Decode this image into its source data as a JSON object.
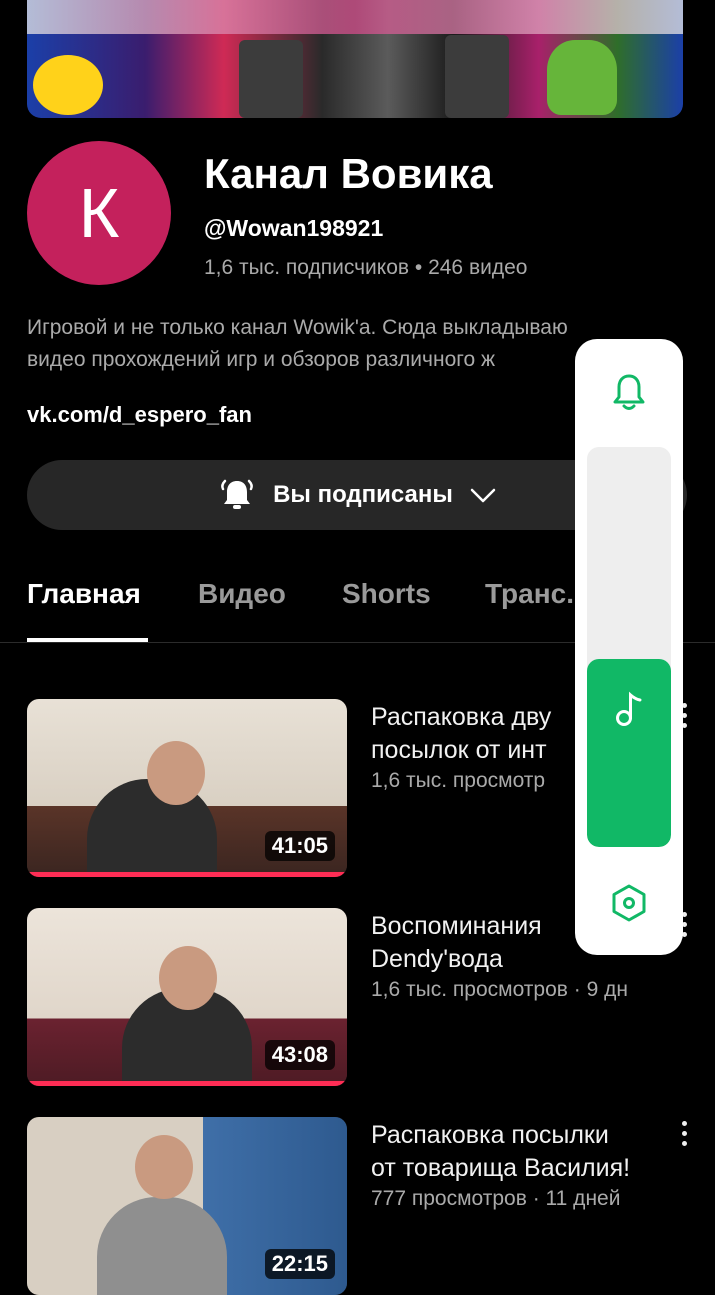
{
  "channel": {
    "avatar_letter": "К",
    "title": "Канал Вовика",
    "handle": "@Wowan198921",
    "stats": "1,6 тыс. подписчиков • 246 видео",
    "description": "Игровой и не только канал Wowik'a. Сюда выкладываю\nвидео прохождений игр и обзоров различного ж",
    "link": "vk.com/d_espero_fan"
  },
  "subscribe": {
    "label": "Вы подписаны",
    "bell_icon": "bell-ringing-icon",
    "chevron_icon": "chevron-down-icon"
  },
  "tabs": [
    {
      "label": "Главная",
      "active": true
    },
    {
      "label": "Видео",
      "active": false
    },
    {
      "label": "Shorts",
      "active": false
    },
    {
      "label": "Транс.",
      "active": false
    }
  ],
  "videos": [
    {
      "title": "Распаковка дву\nпосылок от инт",
      "meta": "1,6 тыс. просмотр",
      "duration": "41:05",
      "watched": 1.0
    },
    {
      "title": "Воспоминания\nDendy'вода",
      "meta": "1,6 тыс. просмотров · 9 дн",
      "duration": "43:08",
      "watched": 1.0
    },
    {
      "title": "Распаковка посылки\nот товарища Василия!",
      "meta": "777 просмотров · 11 дней",
      "duration": "22:15",
      "watched": 0.0
    }
  ],
  "volume_panel": {
    "top_icon": "bell-outline-icon",
    "slider_icon": "music-note-icon",
    "bottom_icon": "settings-hexagon-icon",
    "level": 0.47,
    "accent": "#11b866"
  }
}
